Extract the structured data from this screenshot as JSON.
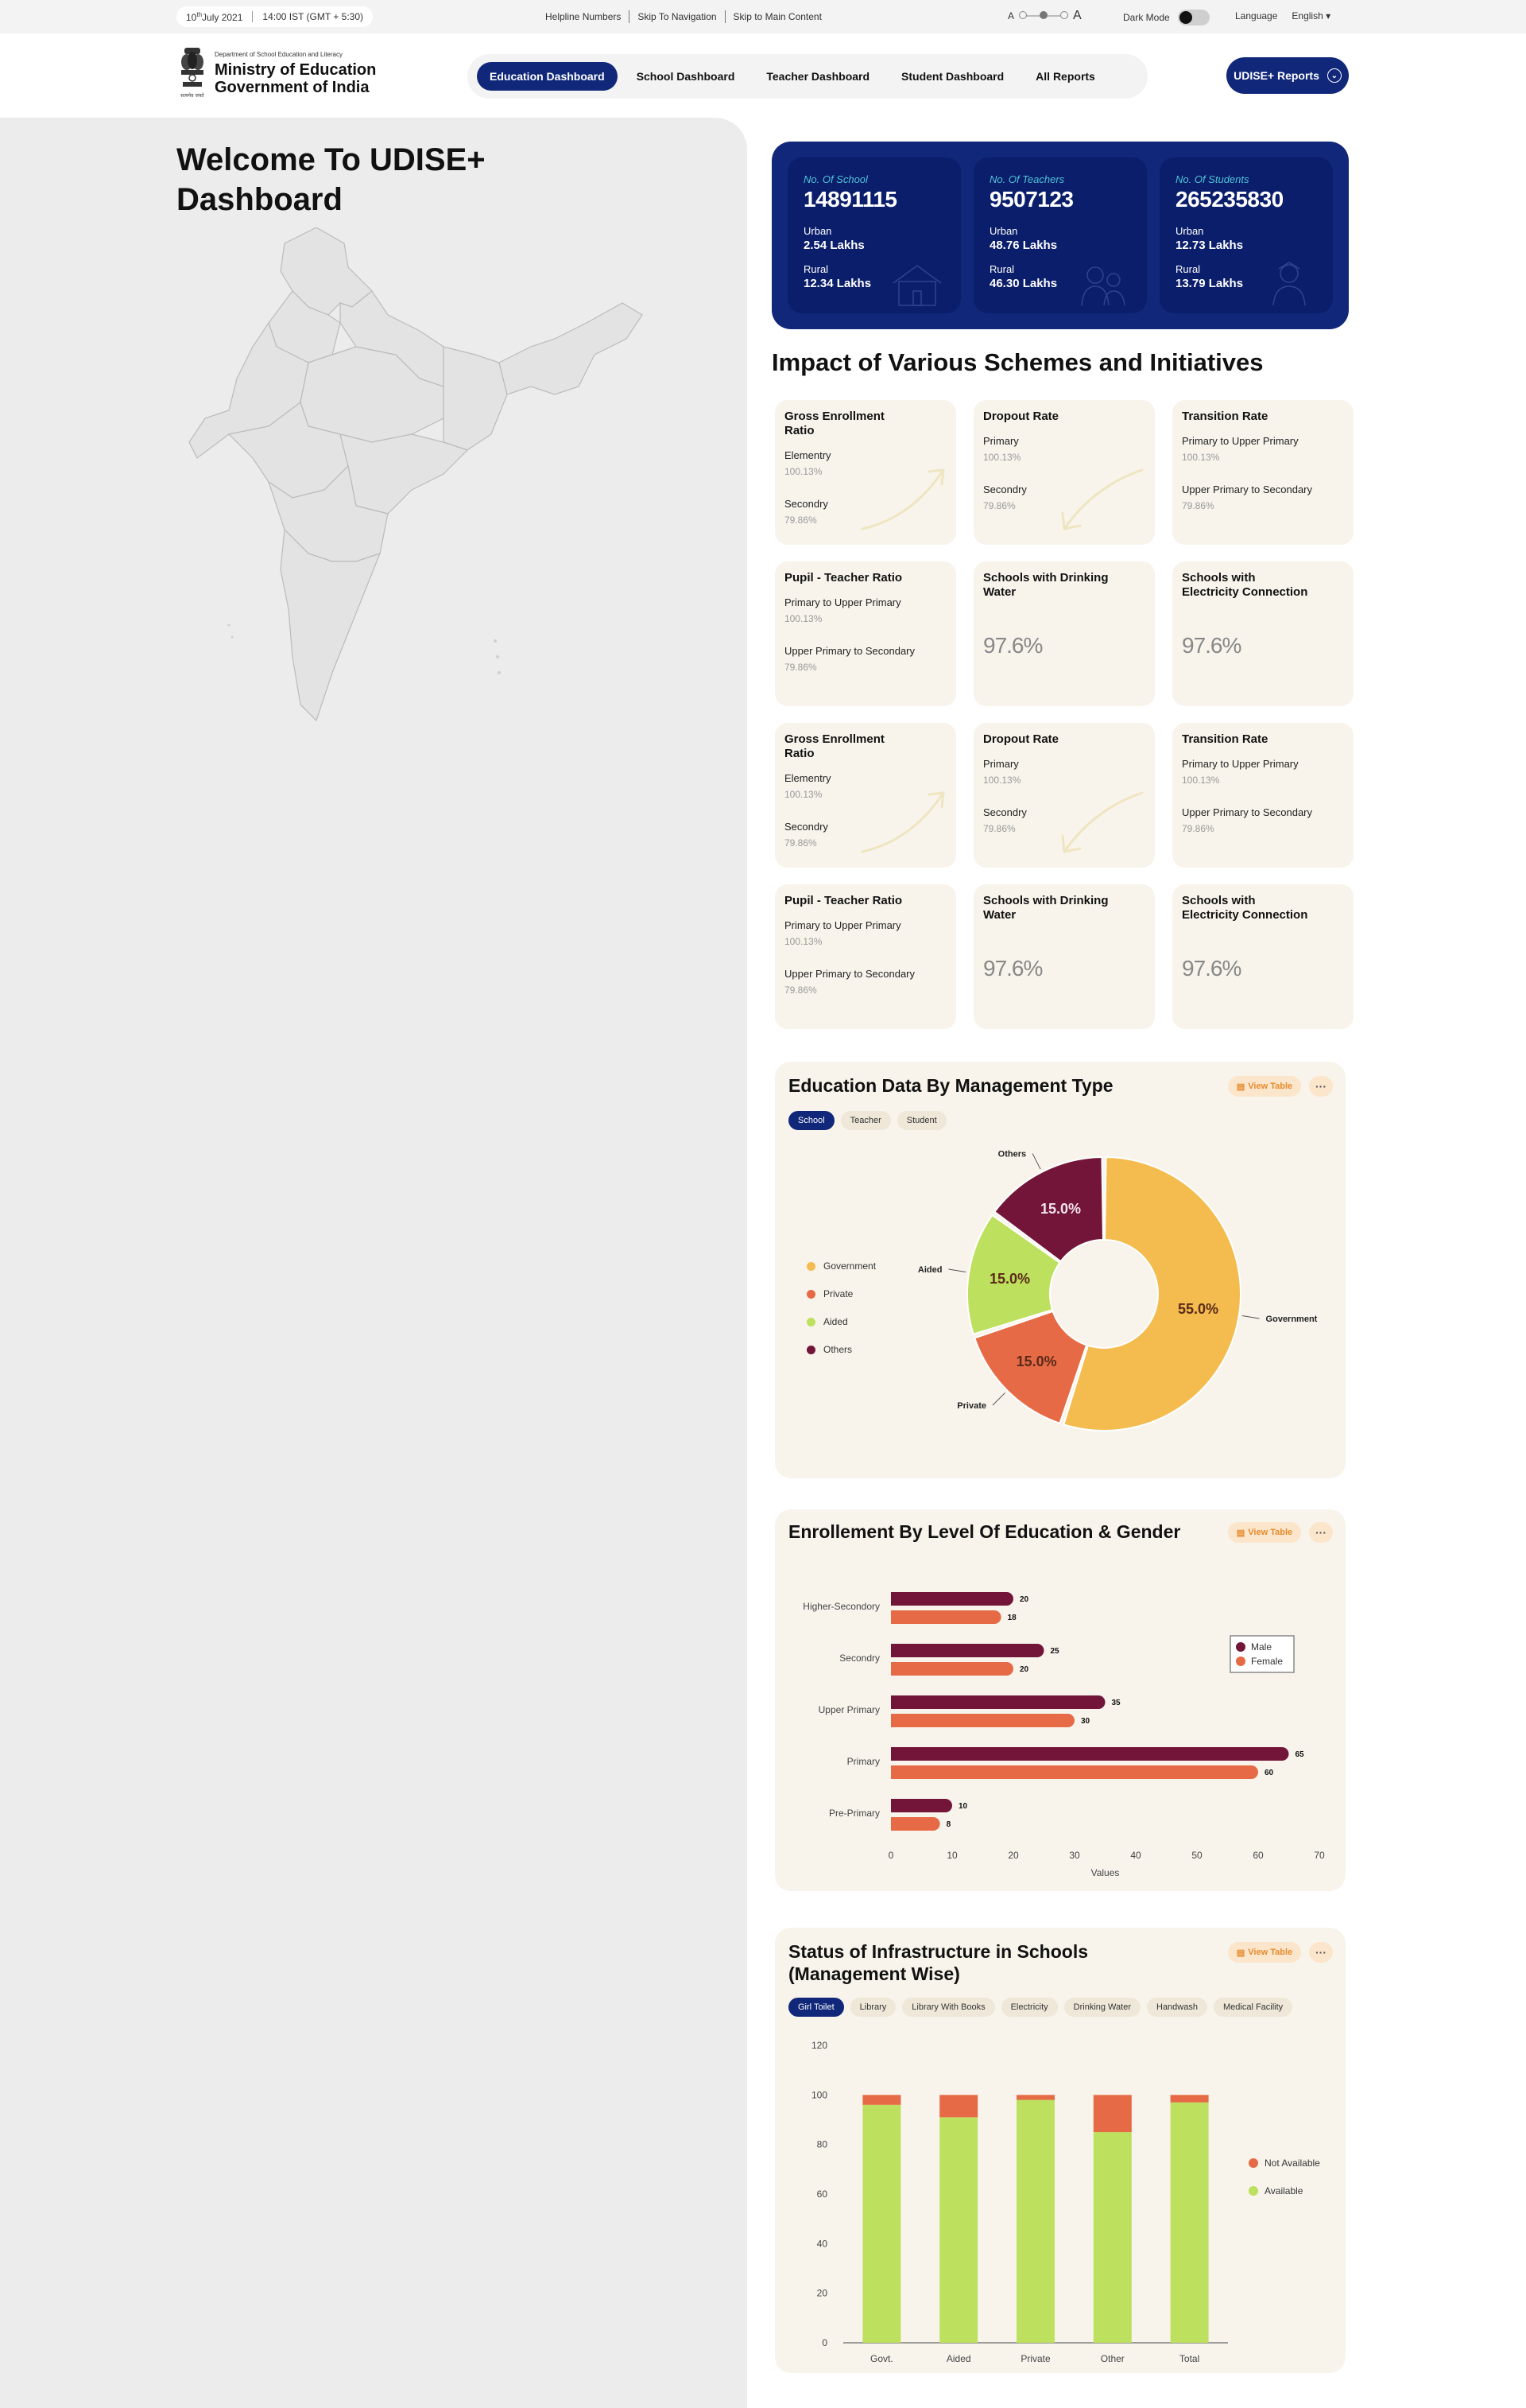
{
  "utility": {
    "date_day": "10",
    "date_sup": "th",
    "date_rest": "July 2021",
    "time": "14:00 IST (GMT + 5:30)",
    "links": [
      "Helpline Numbers",
      "Skip To Navigation",
      "Skip to Main Content"
    ],
    "font_small": "A",
    "font_large": "A",
    "dark_mode": "Dark Mode",
    "language_label": "Language",
    "language_value": "English"
  },
  "header": {
    "dept": "Department of School Education and Literacy",
    "ministry": "Ministry of Education",
    "government": "Government of India",
    "emblem_caption": "सत्यमेव जयते",
    "nav": [
      "Education Dashboard",
      "School Dashboard",
      "Teacher Dashboard",
      "Student Dashboard",
      "All Reports"
    ],
    "cta": "UDISE+ Reports"
  },
  "welcome": "Welcome To UDISE+ Dashboard",
  "stats": [
    {
      "label": "No. Of School",
      "value": "14891115",
      "urban_label": "Urban",
      "urban": "2.54 Lakhs",
      "rural_label": "Rural",
      "rural": "12.34 Lakhs"
    },
    {
      "label": "No. Of Teachers",
      "value": "9507123",
      "urban_label": "Urban",
      "urban": "48.76 Lakhs",
      "rural_label": "Rural",
      "rural": "46.30 Lakhs"
    },
    {
      "label": "No. Of Students",
      "value": "265235830",
      "urban_label": "Urban",
      "urban": "12.73 Lakhs",
      "rural_label": "Rural",
      "rural": "13.79 Lakhs"
    }
  ],
  "impact_title": "Impact of Various Schemes and Initiatives",
  "cards": [
    {
      "title": "Gross Enrollment Ratio",
      "r1": "Elementry",
      "v1": "100.13%",
      "r2": "Secondry",
      "v2": "79.86%",
      "arrow": "up"
    },
    {
      "title": "Dropout Rate",
      "r1": "Primary",
      "v1": "100.13%",
      "r2": "Secondry",
      "v2": "79.86%",
      "arrow": "down"
    },
    {
      "title": "Transition Rate",
      "r1": "Primary to Upper Primary",
      "v1": "100.13%",
      "r2": "Upper Primary to Secondary",
      "v2": "79.86%",
      "arrow": "none"
    },
    {
      "title": "Pupil - Teacher Ratio",
      "r1": "Primary to Upper Primary",
      "v1": "100.13%",
      "r2": "Upper Primary to Secondary",
      "v2": "79.86%",
      "arrow": "none"
    },
    {
      "title": "Schools with Drinking Water",
      "big": "97.6%"
    },
    {
      "title": "Schools with Electricity Connection",
      "big": "97.6%"
    },
    {
      "title": "Gross Enrollment Ratio",
      "r1": "Elementry",
      "v1": "100.13%",
      "r2": "Secondry",
      "v2": "79.86%",
      "arrow": "up"
    },
    {
      "title": "Dropout Rate",
      "r1": "Primary",
      "v1": "100.13%",
      "r2": "Secondry",
      "v2": "79.86%",
      "arrow": "down"
    },
    {
      "title": "Transition Rate",
      "r1": "Primary to Upper Primary",
      "v1": "100.13%",
      "r2": "Upper Primary to Secondary",
      "v2": "79.86%",
      "arrow": "none"
    },
    {
      "title": "Pupil - Teacher Ratio",
      "r1": "Primary to Upper Primary",
      "v1": "100.13%",
      "r2": "Upper Primary to Secondary",
      "v2": "79.86%",
      "arrow": "none"
    },
    {
      "title": "Schools with Drinking Water",
      "big": "97.6%"
    },
    {
      "title": "Schools with Electricity Connection",
      "big": "97.6%"
    }
  ],
  "view_table": "View Table",
  "more": "···",
  "colors": {
    "navy": "#11287a",
    "government": "#f4bc4e",
    "private": "#e66a45",
    "aided": "#bde05e",
    "others": "#731538",
    "male": "#731538",
    "female": "#e66a45",
    "available": "#bde05e",
    "not_available": "#e66a45"
  },
  "management": {
    "title": "Education Data By Management Type",
    "tabs": [
      "School",
      "Teacher",
      "Student"
    ],
    "active_tab": "School"
  },
  "enrollment": {
    "title": "Enrollement By Level Of Education & Gender"
  },
  "infra": {
    "title_line1": "Status of Infrastructure in Schools",
    "title_line2": "(Management Wise)",
    "tabs": [
      "Girl Toilet",
      "Library",
      "Library With Books",
      "Electricity",
      "Drinking Water",
      "Handwash",
      "Medical Facility"
    ],
    "active_tab": "Girl Toilet"
  },
  "chart_data": [
    {
      "type": "pie",
      "title": "Education Data By Management Type",
      "categories": [
        "Government",
        "Private",
        "Aided",
        "Others"
      ],
      "values": [
        55.0,
        15.0,
        15.0,
        15.0
      ],
      "labels": [
        "55.0%",
        "15.0%",
        "15.0%",
        "15.0%"
      ],
      "legend": "left"
    },
    {
      "type": "bar",
      "orientation": "horizontal",
      "title": "Enrollement By Level Of Education & Gender",
      "categories": [
        "Higher-Secondory",
        "Secondry",
        "Upper Primary",
        "Primary",
        "Pre-Primary"
      ],
      "series": [
        {
          "name": "Male",
          "values": [
            20,
            25,
            35,
            65,
            10
          ]
        },
        {
          "name": "Female",
          "values": [
            18,
            20,
            30,
            60,
            8
          ]
        }
      ],
      "xlabel": "Values",
      "xlim": [
        0,
        70
      ],
      "xticks": [
        0,
        10,
        20,
        30,
        40,
        50,
        60,
        70
      ],
      "legend": "right"
    },
    {
      "type": "bar",
      "stacked": true,
      "title": "Status of Infrastructure in Schools (Management Wise)",
      "categories": [
        "Govt.",
        "Aided",
        "Private",
        "Other",
        "Total"
      ],
      "series": [
        {
          "name": "Available",
          "values": [
            96,
            91,
            98,
            85,
            97
          ]
        },
        {
          "name": "Not Available",
          "values": [
            4,
            9,
            2,
            15,
            3
          ]
        }
      ],
      "ylim": [
        0,
        120
      ],
      "yticks": [
        0,
        20,
        40,
        60,
        80,
        100,
        120
      ],
      "legend": "right"
    }
  ]
}
